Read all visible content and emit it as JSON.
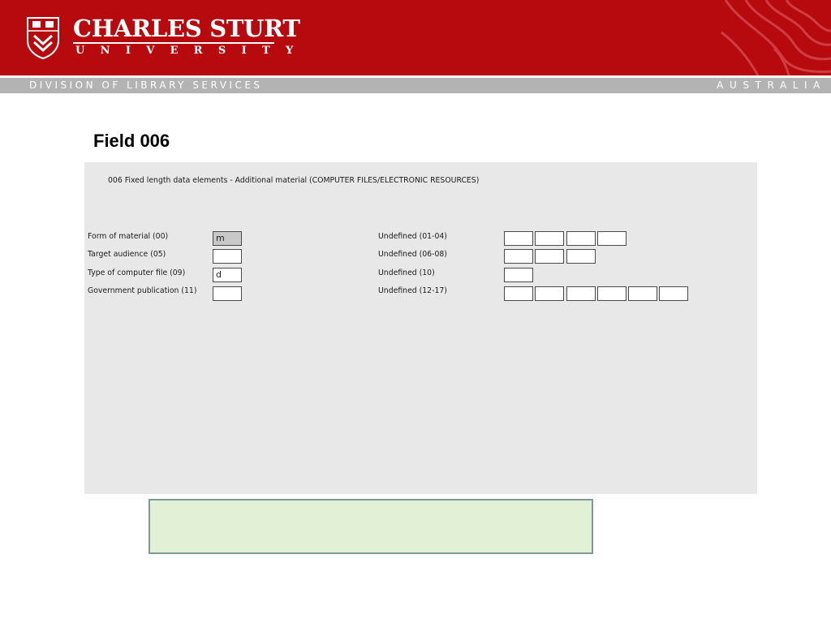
{
  "header": {
    "university_name": "CHARLES STURT",
    "university_sub": "UNIVERSITY",
    "division": "DIVISION OF LIBRARY SERVICES",
    "country": "AUSTRALIA",
    "colors": {
      "brand_red": "#b60a0e",
      "band_grey": "#b3b3b3"
    }
  },
  "slide": {
    "title": "Field 006"
  },
  "form": {
    "heading": "006 Fixed length data elements - Additional material (COMPUTER FILES/ELECTRONIC RESOURCES)",
    "left_fields": [
      {
        "label": "Form of material (00)",
        "value": "m"
      },
      {
        "label": "Target audience (05)",
        "value": ""
      },
      {
        "label": "Type of computer file (09)",
        "value": "d"
      },
      {
        "label": "Government publication (11)",
        "value": ""
      }
    ],
    "right_fields": [
      {
        "label": "Undefined (01-04)",
        "boxes": 4
      },
      {
        "label": "Undefined (06-08)",
        "boxes": 3
      },
      {
        "label": "Undefined (10)",
        "boxes": 1
      },
      {
        "label": "Undefined (12-17)",
        "boxes": 6
      }
    ]
  },
  "note": {
    "text": "",
    "color": "#e2f0d5"
  }
}
